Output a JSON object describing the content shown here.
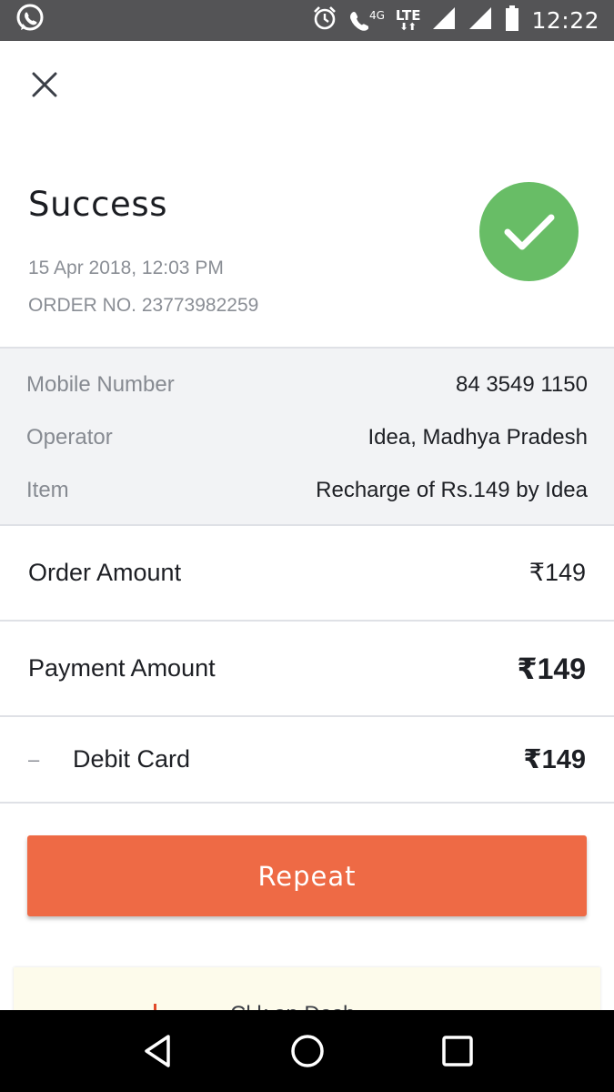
{
  "status_bar": {
    "time": "12:22",
    "network_type": "LTE",
    "call_label": "4G",
    "icons": [
      "whatsapp-icon",
      "alarm-icon",
      "volte-call-icon",
      "lte-icon",
      "signal-icon",
      "signal-icon",
      "battery-icon"
    ]
  },
  "header": {
    "title": "Success",
    "timestamp": "15 Apr 2018, 12:03 PM",
    "order_no": "ORDER NO. 23773982259",
    "status_color": "#68bd66"
  },
  "details": [
    {
      "label": "Mobile Number",
      "value": "84 3549 1150"
    },
    {
      "label": "Operator",
      "value": "Idea, Madhya Pradesh"
    },
    {
      "label": "Item",
      "value": "Recharge of Rs.149 by Idea"
    }
  ],
  "amounts": {
    "order_label": "Order Amount",
    "order_value": "₹149",
    "payment_label": "Payment Amount",
    "payment_value": "₹149",
    "method_dash": "–",
    "method_label": "Debit Card",
    "method_value": "₹149"
  },
  "actions": {
    "repeat_label": "Repeat",
    "accent_color": "#ee6a45"
  },
  "promo": {
    "text": "Cl   k  on  Dash"
  }
}
